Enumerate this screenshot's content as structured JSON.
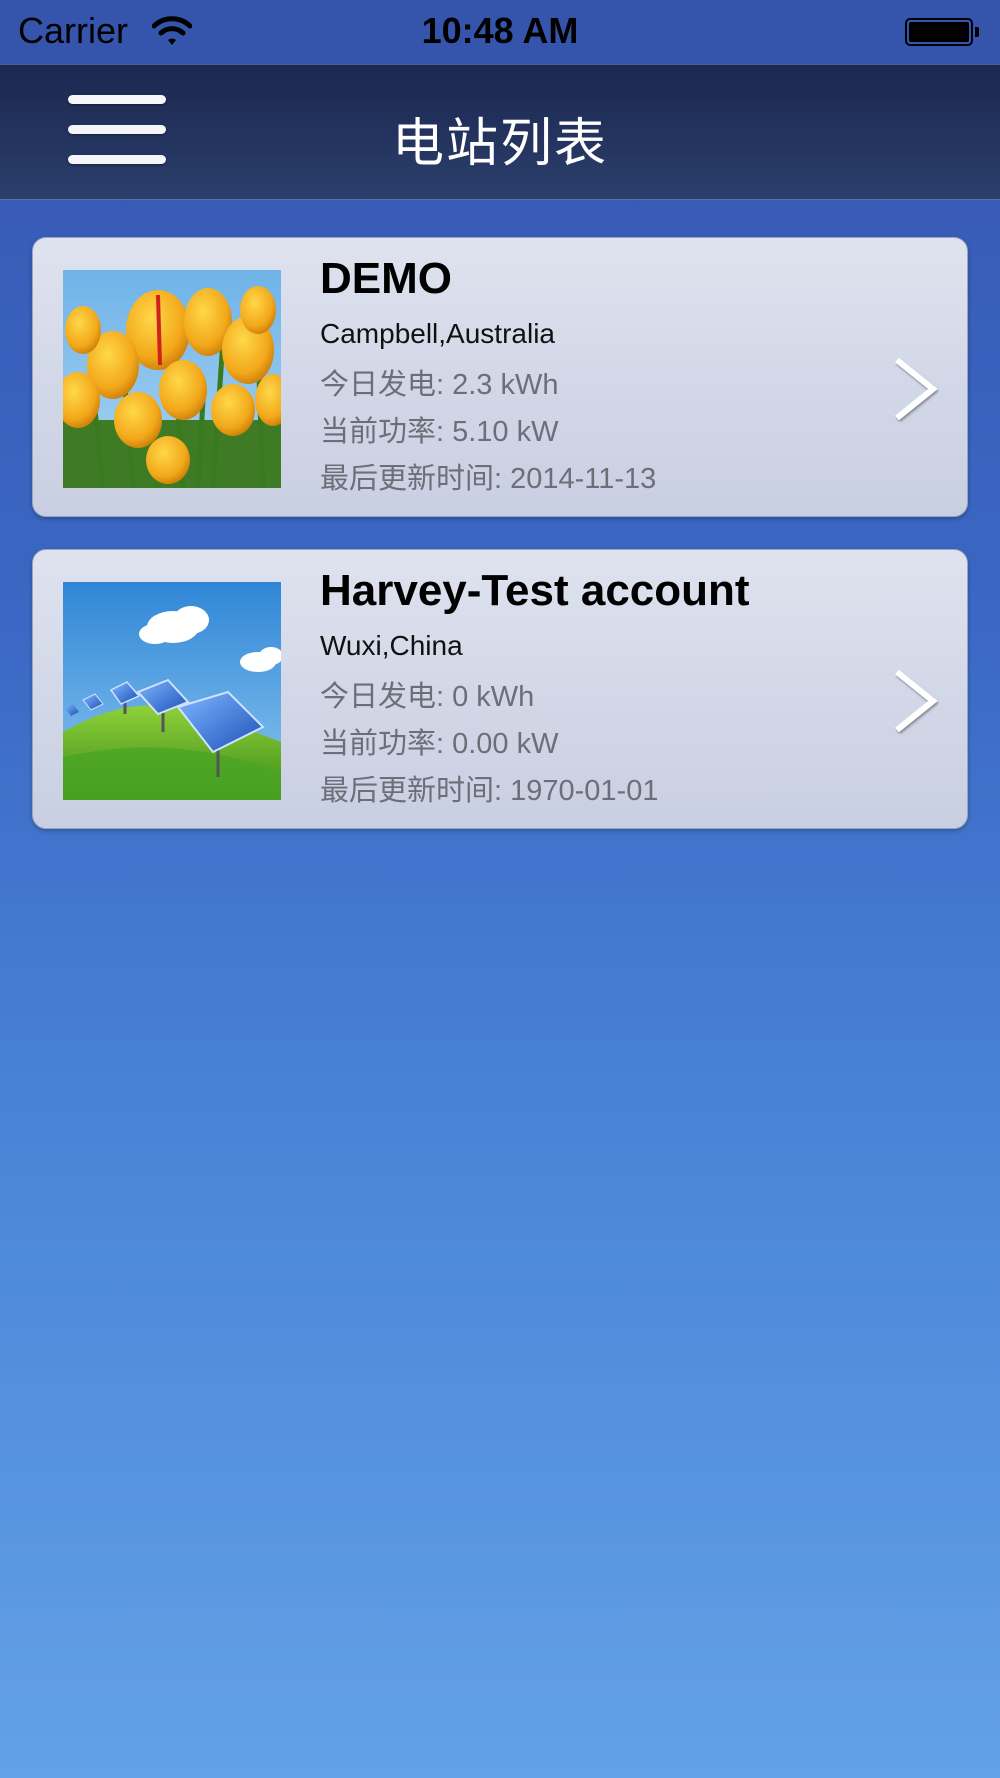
{
  "status_bar": {
    "carrier": "Carrier",
    "time": "10:48 AM",
    "icons": [
      "wifi-icon",
      "battery-icon"
    ]
  },
  "nav": {
    "title": "电站列表",
    "menu_icon": "hamburger-menu-icon"
  },
  "stations": [
    {
      "name": "DEMO",
      "location": "Campbell,Australia",
      "today_generation": "今日发电: 2.3 kWh",
      "current_power": "当前功率: 5.10 kW",
      "last_update": "最后更新时间:  2014-11-13",
      "thumbnail": "yellow-tulips-photo"
    },
    {
      "name": "Harvey-Test account",
      "location": "Wuxi,China",
      "today_generation": "今日发电: 0 kWh",
      "current_power": "当前功率: 0.00 kW",
      "last_update": "最后更新时间:  1970-01-01",
      "thumbnail": "solar-panels-photo"
    }
  ],
  "colors": {
    "background_top": "#3656b0",
    "background_bottom": "#63a1e6",
    "nav_bar": "#243560",
    "card": "#d3d8e8",
    "secondary_text": "#6d6f78"
  }
}
